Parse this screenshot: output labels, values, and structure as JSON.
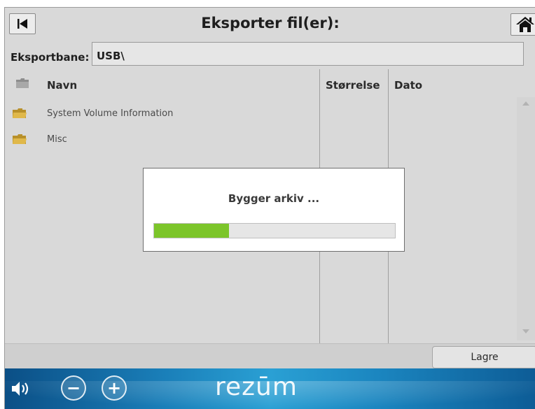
{
  "window": {
    "title": "Eksporter fil(er):"
  },
  "path": {
    "label": "Eksportbane:",
    "value": "USB\\"
  },
  "columns": {
    "name": "Navn",
    "size": "Størrelse",
    "date": "Dato"
  },
  "files": [
    {
      "name": "System Volume Information",
      "icon": "folder-icon"
    },
    {
      "name": "Misc",
      "icon": "folder-icon"
    }
  ],
  "dialog": {
    "message": "Bygger arkiv ...",
    "progress_percent": 31
  },
  "toolbar": {
    "save_label": "Lagre"
  },
  "banner": {
    "brand": "rezūm",
    "minus": "−",
    "plus": "+"
  },
  "colors": {
    "progress": "#7cc52a",
    "banner": "#1a7fb9"
  }
}
